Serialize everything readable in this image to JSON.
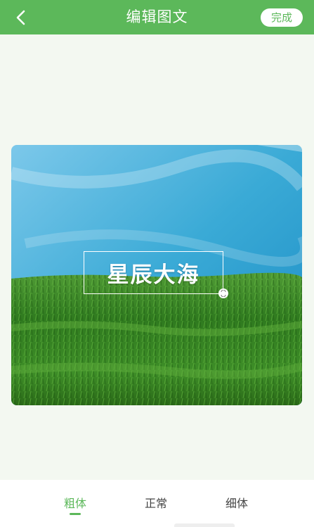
{
  "header": {
    "title": "编辑图文",
    "done_label": "完成",
    "back_icon": "chevron-left-icon",
    "bg_color": "#5cb85a"
  },
  "canvas": {
    "overlay_text": "星辰大海",
    "handle_icon": "resize-handle-icon",
    "sky_color": "#3aaad6",
    "grass_color": "#2f7a1f"
  },
  "font_options": {
    "items": [
      {
        "label": "粗体",
        "selected": true
      },
      {
        "label": "正常",
        "selected": false
      },
      {
        "label": "细体",
        "selected": false
      }
    ],
    "accent_color": "#5cb85a"
  }
}
